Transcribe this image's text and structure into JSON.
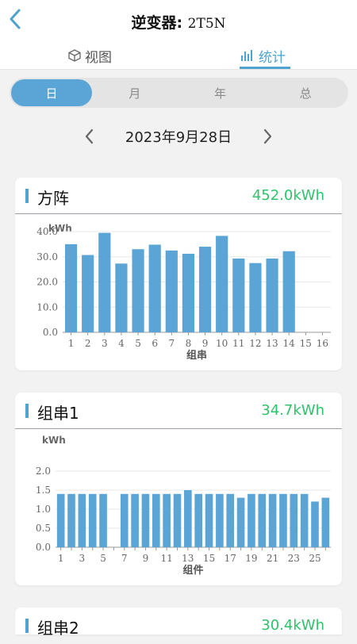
{
  "header": {
    "title_prefix": "逆变器: ",
    "title_code": "2T5N",
    "back_icon": "chevron-left-icon"
  },
  "tabs": [
    {
      "label": "视图",
      "icon": "cube-icon",
      "active": false
    },
    {
      "label": "统计",
      "icon": "bar-chart-icon",
      "active": true
    }
  ],
  "colors": {
    "accent": "#4fa3d1",
    "bar": "#5aa5d6",
    "value_green": "#2ec26a"
  },
  "period_tabs": [
    {
      "label": "日",
      "active": true
    },
    {
      "label": "月",
      "active": false
    },
    {
      "label": "年",
      "active": false
    },
    {
      "label": "总",
      "active": false
    }
  ],
  "date": {
    "text": "2023年9月28日",
    "prev_icon": "chevron-left-icon",
    "next_icon": "chevron-right-icon"
  },
  "cards": [
    {
      "title": "方阵",
      "value": "452.0kWh"
    },
    {
      "title": "组串1",
      "value": "34.7kWh"
    },
    {
      "title": "组串2",
      "value": "30.4kWh"
    }
  ],
  "chart_data": [
    {
      "type": "bar",
      "ylabel": "kWh",
      "xlabel": "组串",
      "ylim": [
        0,
        40
      ],
      "yticks": [
        "0.0",
        "10.0",
        "20.0",
        "30.0",
        "40.0"
      ],
      "categories": [
        "1",
        "2",
        "3",
        "4",
        "5",
        "6",
        "7",
        "8",
        "9",
        "10",
        "11",
        "12",
        "13",
        "14",
        "15",
        "16"
      ],
      "values": [
        35,
        30.7,
        39.5,
        27.3,
        33,
        34.8,
        32.5,
        31.2,
        34,
        38.3,
        29.3,
        27.5,
        29.3,
        32.2,
        0,
        0
      ],
      "grid": true
    },
    {
      "type": "bar",
      "ylabel": "kWh",
      "xlabel": "组件",
      "ylim": [
        0,
        2.0
      ],
      "yticks": [
        "0.0",
        "0.5",
        "1.0",
        "1.5",
        "2.0"
      ],
      "categories": [
        "1",
        "2",
        "3",
        "4",
        "5",
        "6",
        "7",
        "8",
        "9",
        "10",
        "11",
        "12",
        "13",
        "14",
        "15",
        "16",
        "17",
        "18",
        "19",
        "20",
        "21",
        "22",
        "23",
        "24",
        "25",
        "26"
      ],
      "tick_labels": [
        "1",
        "3",
        "5",
        "7",
        "9",
        "11",
        "13",
        "15",
        "17",
        "19",
        "21",
        "23",
        "25"
      ],
      "values": [
        1.4,
        1.4,
        1.4,
        1.4,
        1.4,
        0,
        1.4,
        1.4,
        1.4,
        1.4,
        1.4,
        1.4,
        1.5,
        1.4,
        1.4,
        1.4,
        1.4,
        1.3,
        1.4,
        1.4,
        1.4,
        1.4,
        1.4,
        1.4,
        1.2,
        1.3
      ],
      "grid": true
    }
  ]
}
